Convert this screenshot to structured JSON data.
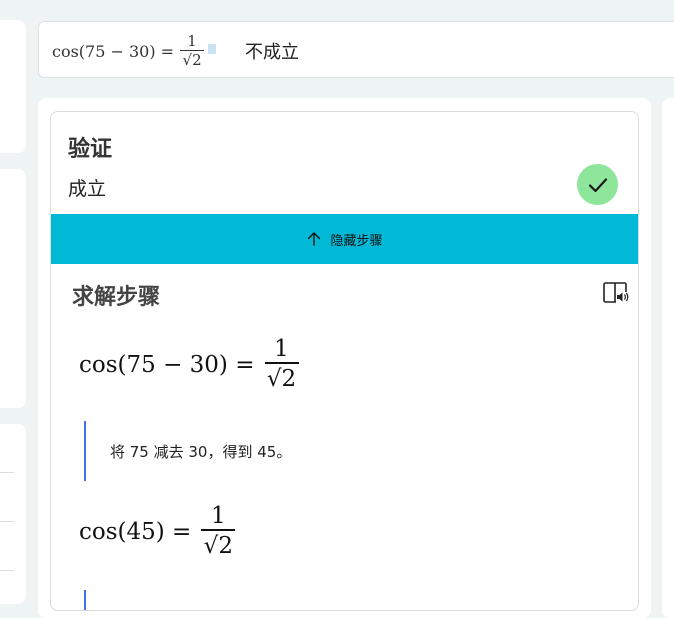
{
  "query": {
    "lhs": "cos(75 − 30) =",
    "numerator": "1",
    "denominator": "√2",
    "result": "不成立"
  },
  "verify": {
    "title": "验证",
    "status": "成立"
  },
  "toggle": {
    "label": "隐藏步骤"
  },
  "steps": {
    "title": "求解步骤",
    "line1": {
      "lhs": "cos(75 − 30) =",
      "numerator": "1",
      "denominator": "√2"
    },
    "explanation": "将 75 减去 30，得到 45。",
    "line2": {
      "lhs": "cos(45) =",
      "numerator": "1",
      "denominator": "√2"
    }
  },
  "colors": {
    "accent": "#00b9d6",
    "success": "#8ee69a",
    "step_rule": "#4a6fe3"
  },
  "icons": [
    "check-icon",
    "arrow-up-icon",
    "immersive-reader-icon"
  ]
}
